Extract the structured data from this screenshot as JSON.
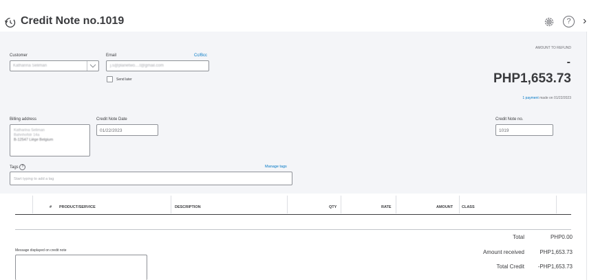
{
  "header": {
    "title": "Credit Note no.1019",
    "history_icon": "history-icon",
    "settings_icon": "gear-icon",
    "help_icon": "help-icon",
    "help_glyph": "?",
    "close_icon": "chevron-right-icon",
    "close_glyph": "›"
  },
  "customer": {
    "label": "Customer",
    "value": "Katharina Seliman"
  },
  "email": {
    "label": "Email",
    "cc_bcc": "Cc/Bcc",
    "value": "j.s@planetwo....t@gmail.com",
    "send_later": "Send later"
  },
  "refund": {
    "label": "AMOUNT TO REFUND",
    "dash": "-",
    "amount": "PHP1,653.73",
    "payment_link": "1 payment",
    "payment_note": "made on 01/22/2023"
  },
  "billing": {
    "label": "Billing address",
    "lines": [
      "Katharina Seliman",
      "Bahnhofstr 14a",
      "B-12547 Liège Belgium"
    ]
  },
  "credit_date": {
    "label": "Credit Note Date",
    "value": "01/22/2023"
  },
  "credit_no": {
    "label": "Credit Note no.",
    "value": "1019"
  },
  "tags": {
    "label": "Tags",
    "manage": "Manage tags",
    "placeholder": "Start typing to add a tag"
  },
  "table": {
    "columns": [
      "#",
      "PRODUCT/SERVICE",
      "DESCRIPTION",
      "QTY",
      "RATE",
      "AMOUNT",
      "CLASS"
    ]
  },
  "message": {
    "label": "Message displayed on credit note"
  },
  "totals": {
    "total_label": "Total",
    "total_value": "PHP0.00",
    "received_label": "Amount received",
    "received_value": "PHP1,653.73",
    "credit_label": "Total Credit",
    "credit_value": "-PHP1,653.73"
  }
}
